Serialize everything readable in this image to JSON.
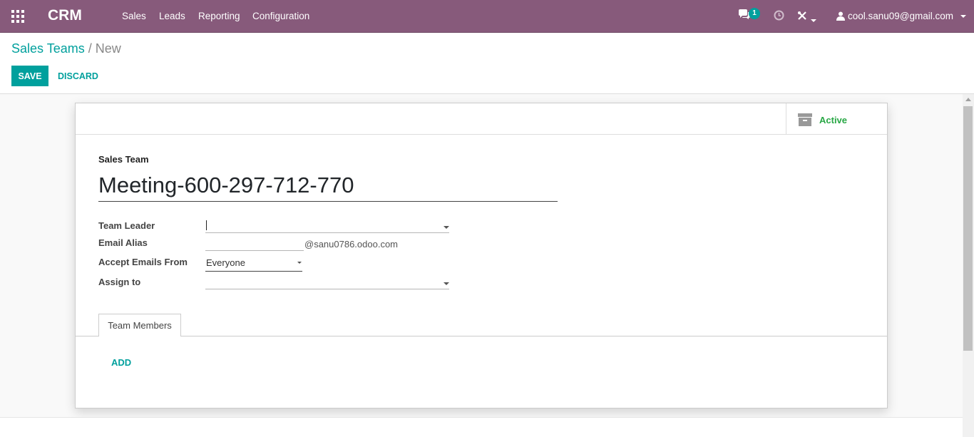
{
  "navbar": {
    "apps_icon": "grid-icon",
    "brand": "CRM",
    "menu": [
      "Sales",
      "Leads",
      "Reporting",
      "Configuration"
    ],
    "chat_icon": "chat-icon",
    "chat_count": "1",
    "activity_icon": "clock-icon",
    "debug_icon": "tools-icon",
    "user_icon": "user-icon",
    "user_email": "cool.sanu09@gmail.com"
  },
  "breadcrumb": {
    "parent": "Sales Teams",
    "separator": "/",
    "current": "New"
  },
  "actions": {
    "save": "SAVE",
    "discard": "DISCARD"
  },
  "button_box": {
    "archive_icon": "archive-icon",
    "active_label": "Active"
  },
  "form": {
    "name_caption": "Sales Team",
    "name_value": "Meeting-600-297-712-770",
    "team_leader_label": "Team Leader",
    "team_leader_value": "",
    "email_alias_label": "Email Alias",
    "email_alias_value": "",
    "alias_domain": "@sanu0786.odoo.com",
    "accept_emails_label": "Accept Emails From",
    "accept_emails_value": "Everyone",
    "assign_to_label": "Assign to",
    "assign_to_value": ""
  },
  "tabs": {
    "team_members": "Team Members",
    "add_label": "ADD"
  },
  "colors": {
    "navbar": "#875a7b",
    "primary": "#00a09d",
    "active": "#28a745"
  }
}
